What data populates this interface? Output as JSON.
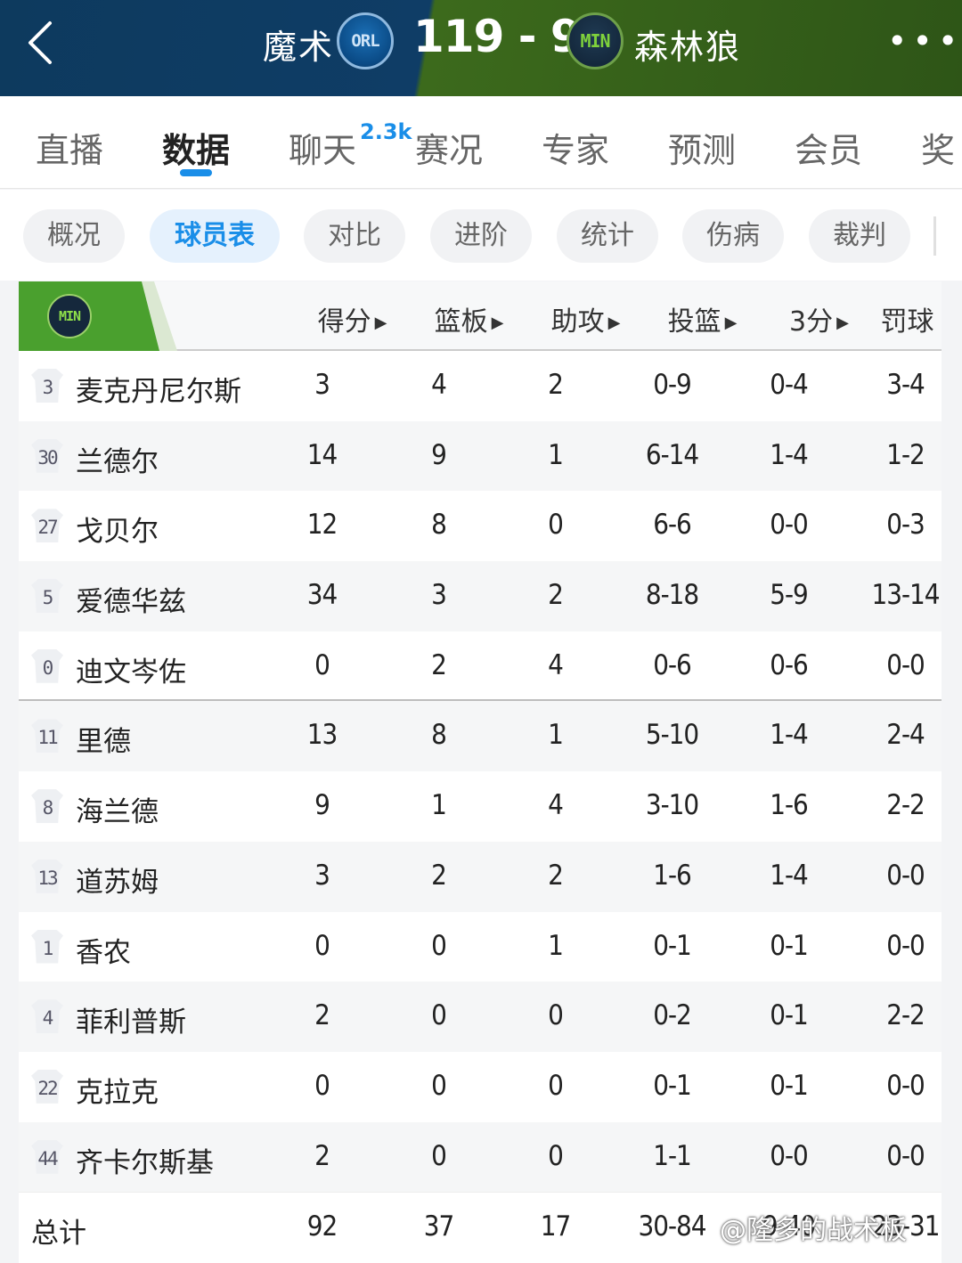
{
  "header": {
    "home_team": "魔术",
    "home_logo_text": "ORL",
    "score": "119 - 92",
    "away_logo_text": "MIN",
    "away_team": "森林狼",
    "more": "•••"
  },
  "main_tabs": [
    "直播",
    "数据",
    "聊天",
    "赛况",
    "专家",
    "预测",
    "会员",
    "奖"
  ],
  "main_tab_active": "数据",
  "chat_badge": "2.3k",
  "sub_tabs": [
    "概况",
    "球员表",
    "对比",
    "进阶",
    "统计",
    "伤病",
    "裁判"
  ],
  "sub_tab_active": "球员表",
  "table": {
    "team_logo_text": "MIN",
    "columns": [
      "得分",
      "篮板",
      "助攻",
      "投篮",
      "3分",
      "罚球"
    ],
    "sortable": [
      true,
      true,
      true,
      true,
      true,
      false
    ],
    "rows": [
      {
        "num": "3",
        "name": "麦克丹尼尔斯",
        "stats": [
          "3",
          "4",
          "2",
          "0-9",
          "0-4",
          "3-4"
        ]
      },
      {
        "num": "30",
        "name": "兰德尔",
        "stats": [
          "14",
          "9",
          "1",
          "6-14",
          "1-4",
          "1-2"
        ]
      },
      {
        "num": "27",
        "name": "戈贝尔",
        "stats": [
          "12",
          "8",
          "0",
          "6-6",
          "0-0",
          "0-3"
        ]
      },
      {
        "num": "5",
        "name": "爱德华兹",
        "stats": [
          "34",
          "3",
          "2",
          "8-18",
          "5-9",
          "13-14"
        ]
      },
      {
        "num": "0",
        "name": "迪文岑佐",
        "stats": [
          "0",
          "2",
          "4",
          "0-6",
          "0-6",
          "0-0"
        ]
      },
      {
        "num": "11",
        "name": "里德",
        "stats": [
          "13",
          "8",
          "1",
          "5-10",
          "1-4",
          "2-4"
        ]
      },
      {
        "num": "8",
        "name": "海兰德",
        "stats": [
          "9",
          "1",
          "4",
          "3-10",
          "1-6",
          "2-2"
        ]
      },
      {
        "num": "13",
        "name": "道苏姆",
        "stats": [
          "3",
          "2",
          "2",
          "1-6",
          "1-4",
          "0-0"
        ]
      },
      {
        "num": "1",
        "name": "香农",
        "stats": [
          "0",
          "0",
          "1",
          "0-1",
          "0-1",
          "0-0"
        ]
      },
      {
        "num": "4",
        "name": "菲利普斯",
        "stats": [
          "2",
          "0",
          "0",
          "0-2",
          "0-1",
          "2-2"
        ]
      },
      {
        "num": "22",
        "name": "克拉克",
        "stats": [
          "0",
          "0",
          "0",
          "0-1",
          "0-1",
          "0-0"
        ]
      },
      {
        "num": "44",
        "name": "齐卡尔斯基",
        "stats": [
          "2",
          "0",
          "0",
          "1-1",
          "0-0",
          "0-0"
        ]
      }
    ],
    "total": {
      "label": "总计",
      "stats": [
        "92",
        "37",
        "17",
        "30-84",
        "9-40",
        "23-31"
      ]
    }
  },
  "watermark": "@隆多的战术板",
  "colors": {
    "accent": "#1a8ee8",
    "min_green": "#4aa02e",
    "header_blue": "#0f3d66",
    "header_green": "#3c6a1c"
  }
}
